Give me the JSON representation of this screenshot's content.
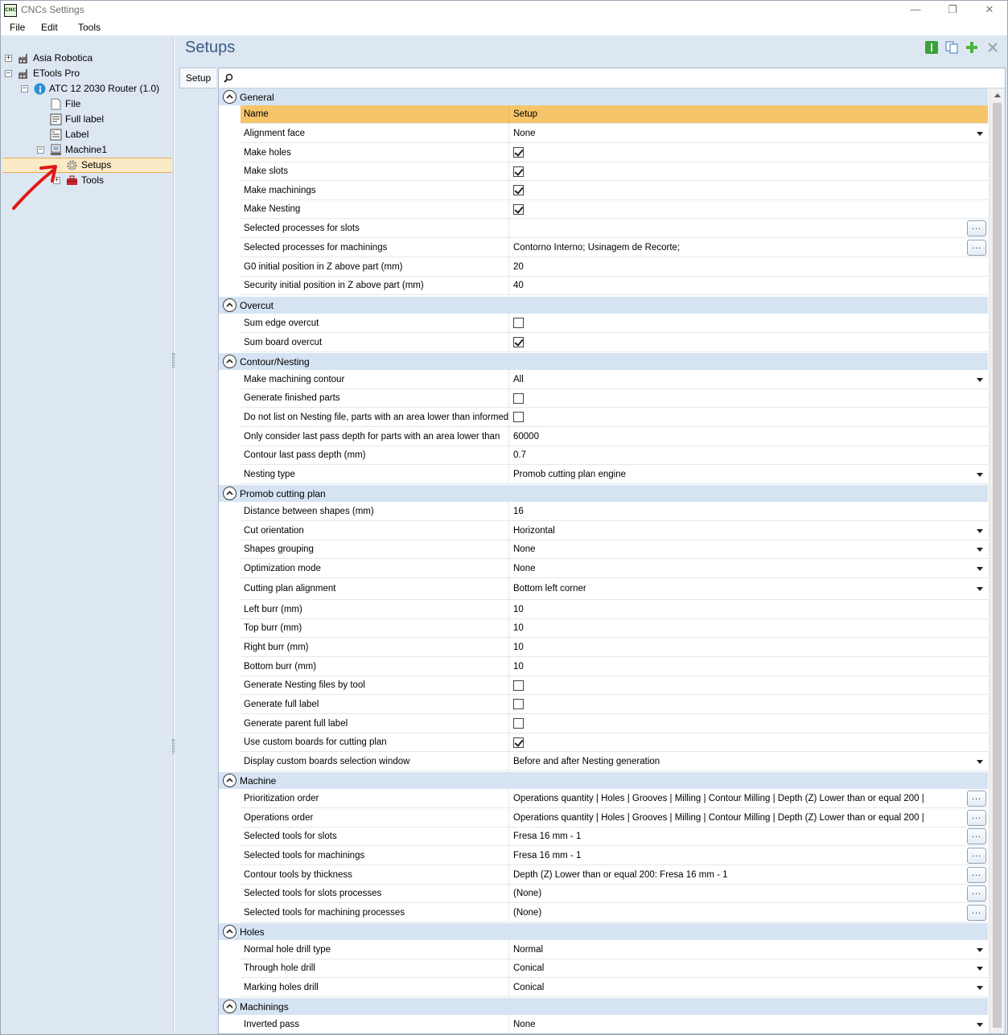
{
  "window": {
    "title": "CNCs Settings",
    "app_icon_text": "CNC",
    "minimize": "—",
    "restore": "❐",
    "close": "✕"
  },
  "menu": {
    "file": "File",
    "edit": "Edit",
    "tools": "Tools"
  },
  "tree": {
    "asia": "Asia Robotica",
    "etools": "ETools Pro",
    "atc": "ATC 12 2030 Router (1.0)",
    "file": "File",
    "full_label": "Full label",
    "label": "Label",
    "machine1": "Machine1",
    "setups": "Setups",
    "tools": "Tools"
  },
  "panel": {
    "title": "Setups",
    "tab": "Setup",
    "search_placeholder": ""
  },
  "grid": {
    "general": {
      "title": "General",
      "header_name": "Name",
      "header_value": "Setup",
      "alignment_face": {
        "name": "Alignment face",
        "value": "None"
      },
      "make_holes": {
        "name": "Make holes",
        "checked": true
      },
      "make_slots": {
        "name": "Make slots",
        "checked": true
      },
      "make_machinings": {
        "name": "Make machinings",
        "checked": true
      },
      "make_nesting": {
        "name": "Make Nesting",
        "checked": true
      },
      "sel_proc_slots": {
        "name": "Selected processes for slots",
        "value": ""
      },
      "sel_proc_machinings": {
        "name": "Selected processes for machinings",
        "value": "Contorno Interno; Usinagem de Recorte;"
      },
      "g0_initial": {
        "name": "G0 initial position in Z above part (mm)",
        "value": "20"
      },
      "security_initial": {
        "name": "Security initial position in Z above part (mm)",
        "value": "40"
      }
    },
    "overcut": {
      "title": "Overcut",
      "sum_edge": {
        "name": "Sum edge overcut",
        "checked": false
      },
      "sum_board": {
        "name": "Sum board overcut",
        "checked": true
      }
    },
    "contour": {
      "title": "Contour/Nesting",
      "make_contour": {
        "name": "Make machining contour",
        "value": "All"
      },
      "gen_finished": {
        "name": "Generate finished parts",
        "checked": false
      },
      "do_not_list": {
        "name": "Do not list on Nesting file, parts with an area lower than informed",
        "checked": false
      },
      "only_last_pass": {
        "name": "Only consider last pass depth for parts with an area lower than",
        "value": "60000"
      },
      "last_pass_depth": {
        "name": "Contour last pass depth (mm)",
        "value": "0.7"
      },
      "nesting_type": {
        "name": "Nesting type",
        "value": "Promob cutting plan engine"
      }
    },
    "promob": {
      "title": "Promob cutting plan",
      "distance": {
        "name": "Distance between shapes (mm)",
        "value": "16"
      },
      "cut_orientation": {
        "name": "Cut orientation",
        "value": "Horizontal"
      },
      "shapes_grouping": {
        "name": "Shapes grouping",
        "value": "None"
      },
      "optimization": {
        "name": "Optimization mode",
        "value": "None"
      },
      "alignment": {
        "name": "Cutting plan alignment",
        "value": "Bottom left corner"
      },
      "left_burr": {
        "name": "Left burr (mm)",
        "value": "10"
      },
      "top_burr": {
        "name": "Top burr (mm)",
        "value": "10"
      },
      "right_burr": {
        "name": "Right burr (mm)",
        "value": "10"
      },
      "bottom_burr": {
        "name": "Bottom burr (mm)",
        "value": "10"
      },
      "gen_nesting_by_tool": {
        "name": "Generate Nesting files by tool",
        "checked": false
      },
      "gen_full_label": {
        "name": "Generate full label",
        "checked": false
      },
      "gen_parent_label": {
        "name": "Generate parent full label",
        "checked": false
      },
      "use_custom_boards": {
        "name": "Use custom boards for cutting plan",
        "checked": true
      },
      "display_custom": {
        "name": "Display custom boards selection window",
        "value": "Before and after Nesting generation"
      }
    },
    "machine": {
      "title": "Machine",
      "prioritization": {
        "name": "Prioritization order",
        "value": "Operations quantity | Holes | Grooves | Milling | Contour Milling | Depth (Z) Lower than or equal 200 |"
      },
      "operations_order": {
        "name": "Operations order",
        "value": "Operations quantity | Holes | Grooves | Milling | Contour Milling | Depth (Z) Lower than or equal 200 |"
      },
      "tools_slots": {
        "name": "Selected tools for slots",
        "value": "Fresa 16 mm - 1"
      },
      "tools_machinings": {
        "name": "Selected tools for machinings",
        "value": "Fresa 16 mm - 1"
      },
      "contour_tools": {
        "name": "Contour tools by thickness",
        "value": "Depth (Z) Lower than or equal 200: Fresa 16 mm - 1"
      },
      "tools_slots_proc": {
        "name": "Selected tools for slots processes",
        "value": "(None)"
      },
      "tools_mach_proc": {
        "name": "Selected tools for machining processes",
        "value": "(None)"
      }
    },
    "holes": {
      "title": "Holes",
      "normal_drill": {
        "name": "Normal hole drill type",
        "value": "Normal"
      },
      "through_drill": {
        "name": "Through hole drill",
        "value": "Conical"
      },
      "marking_drill": {
        "name": "Marking holes drill",
        "value": "Conical"
      }
    },
    "machinings": {
      "title": "Machinings",
      "inverted_pass": {
        "name": "Inverted pass",
        "value": "None"
      }
    },
    "ellipsis": "..."
  },
  "colors": {
    "panel_bg": "#dde7f2",
    "category_bg": "#d6e3f3",
    "header_bg": "#f6c56a",
    "selection_bg": "#fbeac6",
    "title_color": "#3a5a85",
    "annotation_arrow": "#e01818"
  }
}
